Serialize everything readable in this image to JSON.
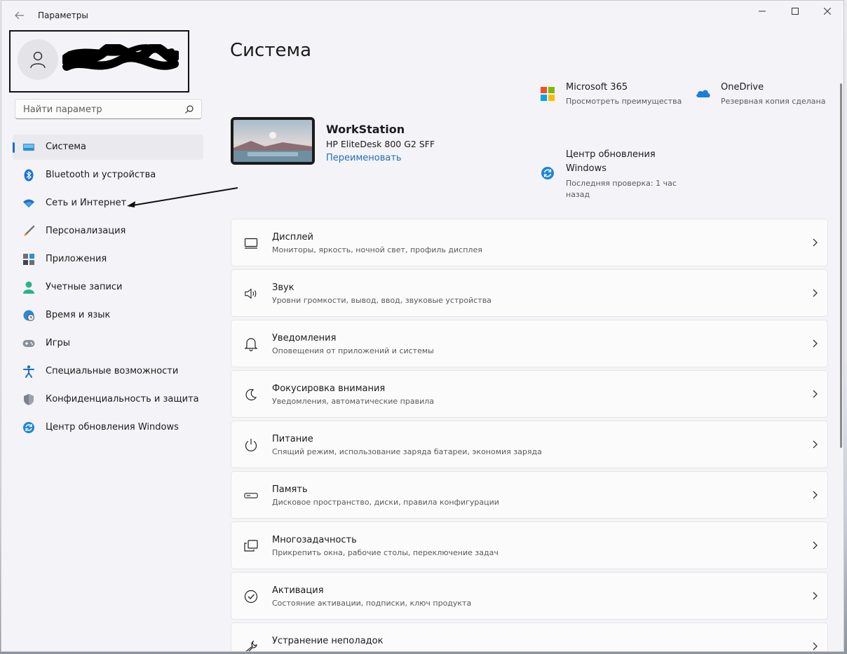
{
  "window": {
    "title": "Параметры"
  },
  "search": {
    "placeholder": "Найти параметр"
  },
  "sidebar": {
    "items": [
      {
        "label": "Система",
        "icon": "laptop-icon",
        "active": true
      },
      {
        "label": "Bluetooth и устройства",
        "icon": "bluetooth-icon"
      },
      {
        "label": "Сеть и Интернет",
        "icon": "wifi-icon"
      },
      {
        "label": "Персонализация",
        "icon": "brush-icon"
      },
      {
        "label": "Приложения",
        "icon": "apps-icon"
      },
      {
        "label": "Учетные записи",
        "icon": "person-icon"
      },
      {
        "label": "Время и язык",
        "icon": "globe-clock-icon"
      },
      {
        "label": "Игры",
        "icon": "gamepad-icon"
      },
      {
        "label": "Специальные возможности",
        "icon": "accessibility-icon"
      },
      {
        "label": "Конфиденциальность и защита",
        "icon": "shield-icon"
      },
      {
        "label": "Центр обновления Windows",
        "icon": "update-icon"
      }
    ]
  },
  "main": {
    "title": "Система",
    "device": {
      "name": "WorkStation",
      "model": "HP EliteDesk 800 G2 SFF",
      "rename_label": "Переименовать"
    },
    "promos": {
      "m365": {
        "title": "Microsoft 365",
        "subtitle": "Просмотреть преимущества"
      },
      "onedrive": {
        "title": "OneDrive",
        "subtitle": "Резервная копия сделана"
      },
      "update": {
        "title_line1": "Центр обновления",
        "title_line2": "Windows",
        "subtitle_line1": "Последняя проверка: 1 час",
        "subtitle_line2": "назад"
      }
    },
    "cards": [
      {
        "title": "Дисплей",
        "subtitle": "Мониторы, яркость, ночной свет, профиль дисплея",
        "icon": "display-icon"
      },
      {
        "title": "Звук",
        "subtitle": "Уровни громкости, вывод, ввод, звуковые устройства",
        "icon": "speaker-icon"
      },
      {
        "title": "Уведомления",
        "subtitle": "Оповещения от приложений и системы",
        "icon": "bell-icon"
      },
      {
        "title": "Фокусировка внимания",
        "subtitle": "Уведомления, автоматические правила",
        "icon": "moon-icon"
      },
      {
        "title": "Питание",
        "subtitle": "Спящий режим, использование заряда батареи, экономия заряда",
        "icon": "power-icon"
      },
      {
        "title": "Память",
        "subtitle": "Дисковое пространство, диски, правила конфигурации",
        "icon": "storage-icon"
      },
      {
        "title": "Многозадачность",
        "subtitle": "Прикрепить окна, рабочие столы, переключение задач",
        "icon": "multitask-icon"
      },
      {
        "title": "Активация",
        "subtitle": "Состояние активации, подписки, ключ продукта",
        "icon": "check-circle-icon"
      },
      {
        "title": "Устранение неполадок",
        "subtitle": "",
        "icon": "wrench-icon"
      }
    ]
  },
  "colors": {
    "accent": "#1d6ec4",
    "link": "#1f6fb5",
    "window_bg": "#f4f3f7",
    "card_bg": "#fbfbfb"
  }
}
